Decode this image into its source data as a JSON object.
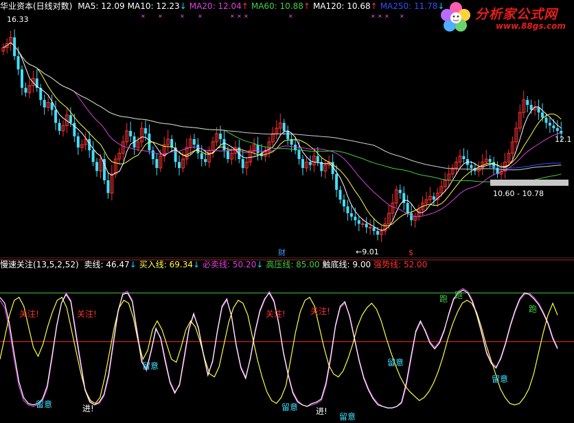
{
  "header": {
    "stock_name": "华业资本(日线对数)",
    "ma": [
      {
        "label": "MA5: 12.09",
        "color": "#ffffff"
      },
      {
        "label": "MA10: 12.23",
        "color": "#ffffff",
        "arrow": "↓",
        "arrow_color": "#00e0ff"
      },
      {
        "label": "MA20: 12.04",
        "color": "#e040e0",
        "arrow": "↑",
        "arrow_color": "#ff3030"
      },
      {
        "label": "MA60: 10.88",
        "color": "#40d040",
        "arrow": "↑",
        "arrow_color": "#ff3030"
      },
      {
        "label": "MA120: 10.68",
        "color": "#ffffff",
        "arrow": "↑",
        "arrow_color": "#ff3030"
      },
      {
        "label": "MA250: 11.78",
        "color": "#3050ff",
        "arrow": "↓",
        "arrow_color": "#00e0ff"
      }
    ]
  },
  "indicator_header": {
    "name": "慢速关注",
    "params": "(13,5,2,52)",
    "items": [
      {
        "label": "卖线: 46.47",
        "color": "#ffffff",
        "arrow": "↓",
        "arrow_color": "#00e0ff"
      },
      {
        "label": "买入线: 69.34",
        "color": "#ffff40",
        "arrow": "↓",
        "arrow_color": "#00e0ff"
      },
      {
        "label": "必卖线: 50.20",
        "color": "#e040e0",
        "arrow": "↓",
        "arrow_color": "#00e0ff"
      },
      {
        "label": "高压线: 85.00",
        "color": "#40d040"
      },
      {
        "label": "触底线: 9.00",
        "color": "#ffffff"
      },
      {
        "label": "强势线: 52.00",
        "color": "#ff3030"
      }
    ]
  },
  "logo": {
    "title": "分析家公式网",
    "url": "www.88gs.com"
  },
  "chart_data": [
    {
      "type": "candlestick",
      "title": "华业资本(日线对数)",
      "log_scale": true,
      "ylim": [
        8.5,
        17.5
      ],
      "annotations": [
        {
          "text": "16.33",
          "kind": "high"
        },
        {
          "text": "9.01",
          "kind": "low"
        },
        {
          "text": "12.1",
          "kind": "price-label"
        },
        {
          "text": "10.60 - 10.78",
          "kind": "range-label"
        },
        {
          "text": "财",
          "kind": "marker"
        },
        {
          "text": "$",
          "kind": "marker"
        }
      ],
      "close": [
        15.8,
        16.0,
        16.3,
        15.4,
        14.8,
        14.0,
        13.8,
        14.1,
        14.4,
        14.0,
        13.5,
        13.2,
        13.4,
        13.1,
        12.6,
        12.3,
        12.5,
        12.9,
        12.6,
        12.1,
        11.7,
        11.8,
        12.0,
        11.6,
        11.2,
        10.9,
        11.3,
        10.6,
        10.2,
        10.8,
        11.3,
        11.5,
        11.9,
        12.3,
        12.1,
        11.7,
        11.9,
        12.4,
        12.2,
        11.6,
        11.3,
        11.0,
        11.4,
        11.8,
        12.0,
        11.7,
        11.2,
        11.0,
        11.3,
        11.7,
        12.0,
        11.8,
        11.5,
        11.3,
        11.2,
        11.6,
        11.9,
        12.2,
        12.0,
        11.6,
        11.3,
        11.5,
        11.7,
        11.3,
        11.0,
        11.2,
        11.6,
        11.8,
        11.5,
        11.4,
        11.6,
        11.9,
        12.2,
        12.4,
        12.6,
        12.3,
        12.0,
        11.8,
        11.6,
        11.3,
        11.0,
        11.2,
        11.1,
        11.4,
        11.2,
        10.9,
        11.1,
        11.2,
        10.8,
        10.3,
        10.0,
        9.8,
        9.6,
        9.5,
        9.4,
        9.3,
        9.3,
        9.2,
        9.2,
        9.1,
        9.0,
        9.1,
        9.3,
        9.6,
        9.9,
        10.3,
        10.2,
        9.9,
        9.6,
        9.4,
        9.5,
        9.7,
        9.9,
        10.0,
        10.1,
        10.0,
        10.2,
        10.4,
        10.6,
        10.8,
        11.0,
        11.2,
        11.4,
        11.3,
        11.1,
        11.0,
        10.9,
        11.0,
        11.2,
        11.3,
        11.2,
        11.0,
        10.8,
        10.9,
        11.2,
        11.5,
        11.9,
        12.4,
        13.0,
        13.5,
        13.3,
        13.1,
        13.2,
        13.0,
        12.8,
        12.6,
        12.5,
        12.4,
        12.3,
        12.2
      ],
      "ma_series": [
        {
          "name": "MA5",
          "color": "#ffffff"
        },
        {
          "name": "MA10",
          "color": "#ffff40"
        },
        {
          "name": "MA20",
          "color": "#e040e0"
        },
        {
          "name": "MA60",
          "color": "#40d040"
        },
        {
          "name": "MA120",
          "color": "#d0d0d0"
        },
        {
          "name": "MA250",
          "color": "#3050ff"
        }
      ]
    },
    {
      "type": "line",
      "title": "慢速关注",
      "ylim": [
        0,
        100
      ],
      "hlines": [
        {
          "name": "高压线",
          "value": 85,
          "color": "#40d040"
        },
        {
          "name": "强势线",
          "value": 52,
          "color": "#ff3030"
        },
        {
          "name": "触底线",
          "value": 9,
          "color": "#ffffff"
        }
      ],
      "series": [
        {
          "name": "必卖线",
          "color": "#e040e0",
          "values": [
            80,
            75,
            60,
            40,
            22,
            12,
            9,
            8,
            9,
            12,
            20,
            40,
            62,
            78,
            85,
            80,
            60,
            40,
            20,
            12,
            9,
            10,
            15,
            28,
            50,
            72,
            85,
            86,
            80,
            60,
            40,
            32,
            45,
            60,
            55,
            40,
            25,
            18,
            22,
            40,
            60,
            70,
            62,
            45,
            30,
            38,
            58,
            75,
            80,
            70,
            50,
            35,
            28,
            40,
            58,
            72,
            80,
            86,
            80,
            65,
            45,
            30,
            18,
            12,
            9,
            8,
            9,
            10,
            12,
            22,
            40,
            62,
            75,
            78,
            70,
            55,
            40,
            28,
            20,
            14,
            10,
            8,
            7,
            7,
            8,
            10,
            22,
            40,
            58,
            65,
            60,
            52,
            48,
            52,
            60,
            70,
            80,
            86,
            88,
            86,
            80,
            70,
            58,
            45,
            38,
            35,
            40,
            50,
            62,
            72,
            80,
            84,
            85,
            82,
            78,
            72,
            65,
            55,
            48
          ]
        },
        {
          "name": "买入线",
          "color": "#ffff40",
          "values": [
            40,
            55,
            70,
            80,
            82,
            76,
            62,
            48,
            42,
            50,
            62,
            72,
            80,
            82,
            75,
            60,
            45,
            30,
            18,
            12,
            10,
            14,
            28,
            45,
            62,
            75,
            80,
            78,
            68,
            52,
            40,
            46,
            60,
            66,
            60,
            50,
            40,
            38,
            48,
            60,
            66,
            62,
            52,
            40,
            30,
            28,
            35,
            50,
            65,
            75,
            80,
            78,
            70,
            55,
            40,
            28,
            18,
            12,
            10,
            14,
            22,
            40,
            58,
            72,
            80,
            82,
            76,
            62,
            48,
            36,
            30,
            28,
            32,
            40,
            50,
            62,
            70,
            75,
            78,
            74,
            66,
            55,
            45,
            36,
            28,
            22,
            18,
            15,
            12,
            14,
            18,
            24,
            32,
            42,
            54,
            64,
            72,
            78,
            80,
            78,
            72,
            62,
            50,
            40,
            30,
            20,
            14,
            10,
            9,
            10,
            14,
            20,
            30,
            44,
            58,
            70,
            78,
            70
          ]
        },
        {
          "name": "卖线",
          "color": "#ffffff",
          "values": [
            82,
            78,
            64,
            44,
            25,
            14,
            10,
            9,
            10,
            13,
            22,
            42,
            63,
            78,
            84,
            79,
            58,
            38,
            19,
            11,
            9,
            11,
            16,
            30,
            52,
            73,
            84,
            85,
            79,
            58,
            38,
            33,
            46,
            61,
            54,
            38,
            24,
            17,
            23,
            42,
            61,
            71,
            61,
            44,
            29,
            39,
            59,
            76,
            81,
            69,
            49,
            34,
            27,
            41,
            59,
            73,
            81,
            85,
            79,
            64,
            44,
            29,
            17,
            11,
            9,
            8,
            10,
            11,
            13,
            24,
            42,
            63,
            76,
            79,
            69,
            54,
            39,
            27,
            19,
            13,
            9,
            8,
            7,
            7,
            8,
            11,
            24,
            42,
            59,
            66,
            59,
            51,
            47,
            51,
            59,
            71,
            81,
            85,
            87,
            85,
            79,
            69,
            57,
            44,
            37,
            34,
            41,
            51,
            63,
            73,
            81,
            85,
            84,
            81,
            77,
            71,
            64,
            54,
            47
          ]
        }
      ],
      "annotations": [
        {
          "text": "关注!",
          "color": "#ff3030"
        },
        {
          "text": "关注!",
          "color": "#ff3030"
        },
        {
          "text": "关注!",
          "color": "#ff3030"
        },
        {
          "text": "关注!",
          "color": "#ff3030"
        },
        {
          "text": "留意",
          "color": "#40e0ff"
        },
        {
          "text": "留意",
          "color": "#40e0ff"
        },
        {
          "text": "留意",
          "color": "#40e0ff"
        },
        {
          "text": "留意",
          "color": "#40e0ff"
        },
        {
          "text": "留意",
          "color": "#40e0ff"
        },
        {
          "text": "留意",
          "color": "#40e0ff"
        },
        {
          "text": "进!",
          "color": "#ffffff"
        },
        {
          "text": "进!",
          "color": "#ffffff"
        },
        {
          "text": "跑",
          "color": "#40d040"
        },
        {
          "text": "跑",
          "color": "#40d040"
        },
        {
          "text": "跑",
          "color": "#40d040"
        }
      ]
    }
  ]
}
